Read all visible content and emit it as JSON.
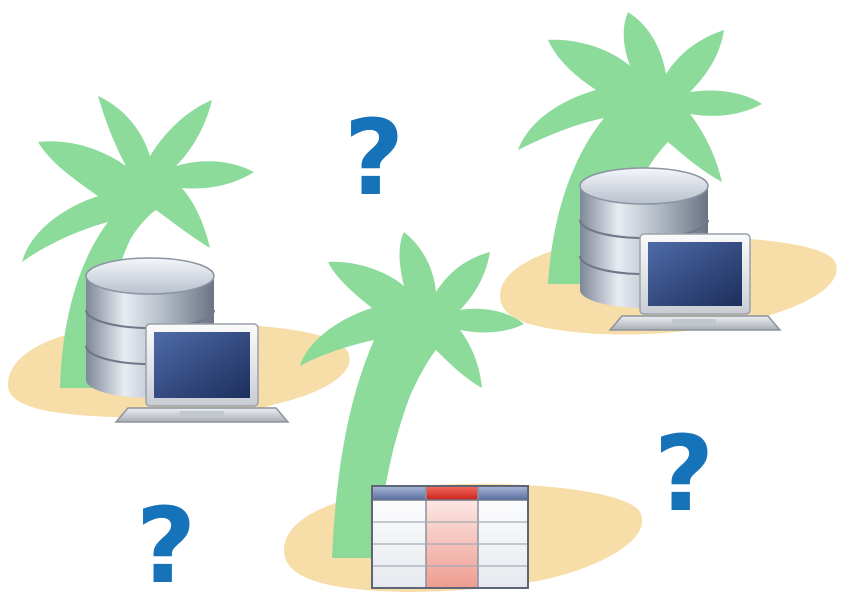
{
  "question_marks": [
    "?",
    "?",
    "?"
  ],
  "colors": {
    "island_sand": "#F7DDA8",
    "palm_green": "#86D996",
    "question_mark_blue": "#1672B9",
    "highlight_column_red": "#E53A2E",
    "table_header_blue": "#6E83B4",
    "laptop_screen": "#2E4A86",
    "database_silver": "#B7BFCB"
  },
  "icons": [
    "palm-tree-icon",
    "island-icon",
    "database-icon",
    "laptop-icon",
    "table-icon",
    "question-mark-icon"
  ]
}
